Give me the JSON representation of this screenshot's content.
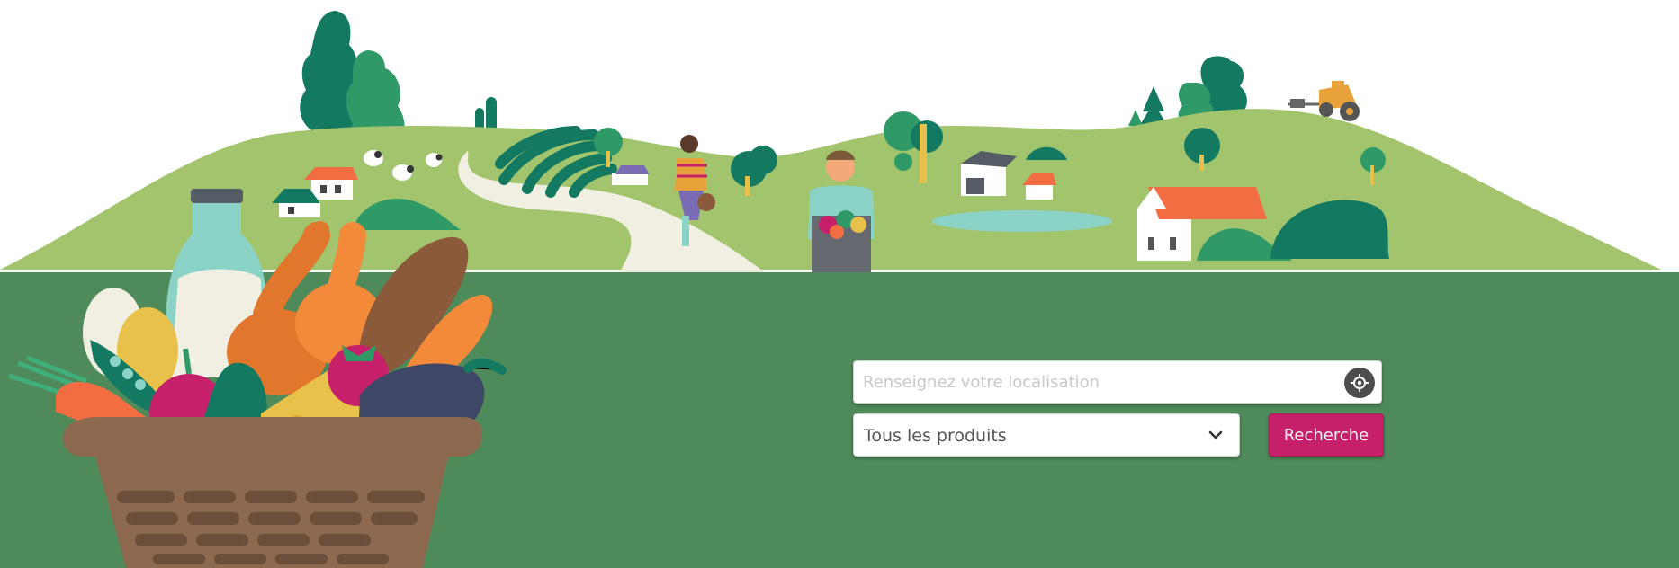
{
  "hero": {
    "illustration_name": "countryside farm landscape with produce basket",
    "colors": {
      "sky": "#ffffff",
      "hills": "#a1c46d",
      "band": "#4f8a5b",
      "accent": "#c7206a"
    }
  },
  "search": {
    "location_placeholder": "Renseignez votre localisation",
    "location_value": "",
    "geolocate_icon": "crosshair-icon",
    "product_select_value": "Tous les produits",
    "product_select_icon": "chevron-down-icon",
    "submit_label": "Recherche"
  }
}
